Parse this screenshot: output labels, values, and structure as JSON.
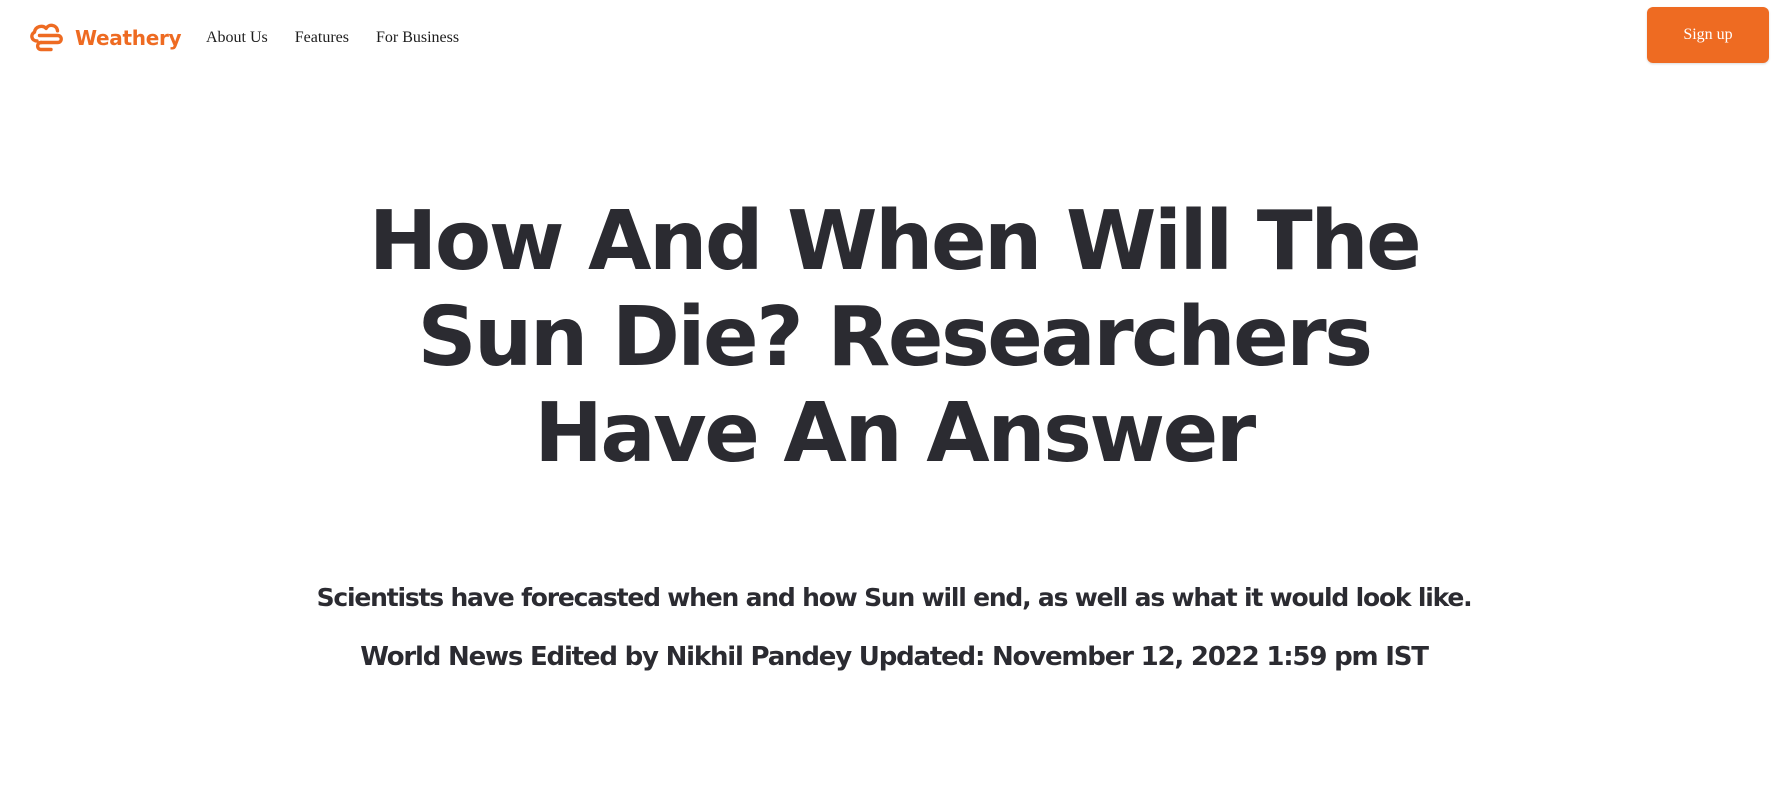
{
  "brand": {
    "name": "Weathery",
    "icon": "weathery-cloud-logo-icon",
    "color": "#ee6b22"
  },
  "nav": {
    "items": [
      {
        "label": "About Us"
      },
      {
        "label": "Features"
      },
      {
        "label": "For Business"
      }
    ],
    "signup_label": "Sign up"
  },
  "article": {
    "title": "How And When Will The Sun Die? Researchers Have An Answer",
    "subtitle": "Scientists have forecasted when and how Sun will end, as well as what it would look like.",
    "meta": "World News Edited by Nikhil Pandey Updated: November 12, 2022 1:59 pm IST",
    "text_color": "#2b2b31"
  }
}
